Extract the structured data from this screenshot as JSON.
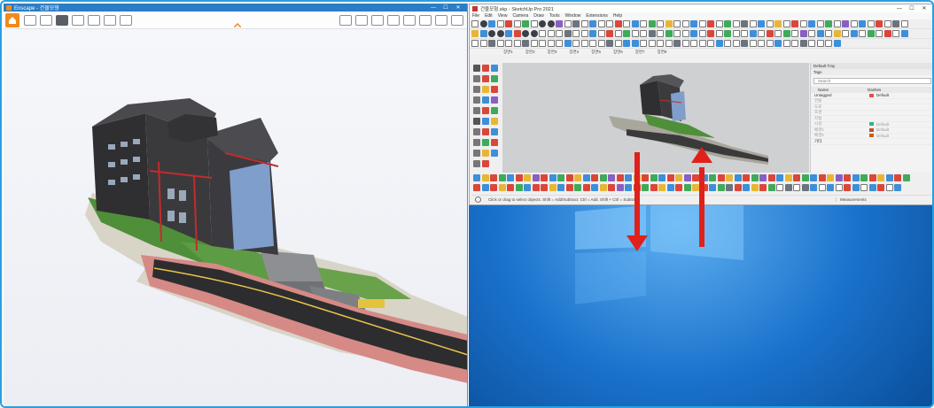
{
  "left_window": {
    "title": "Enscape - 건물모형",
    "controls": {
      "minimize": "—",
      "maximize": "☐",
      "close": "✕"
    }
  },
  "sketchup": {
    "title": "건물모형.skp - SketchUp Pro 2021",
    "controls": {
      "minimize": "—",
      "maximize": "☐",
      "close": "✕"
    },
    "menu": [
      "File",
      "Edit",
      "View",
      "Camera",
      "Draw",
      "Tools",
      "Window",
      "Extensions",
      "Help"
    ],
    "scene_tabs": [
      "장면1",
      "장면2",
      "장면3",
      "장면4",
      "장면5",
      "장면6",
      "장면7",
      "장면8"
    ],
    "tray": {
      "title": "Default Tray",
      "section": "Tags",
      "search_placeholder": "Search",
      "col_name": "Name",
      "col_dashes": "Dashes",
      "rows": [
        {
          "name": "Untagged",
          "dash": "Default",
          "color": "#e05050"
        },
        {
          "name": "건물",
          "dash": "",
          "color": ""
        },
        {
          "name": "도로",
          "dash": "",
          "color": ""
        },
        {
          "name": "조경",
          "dash": "",
          "color": ""
        },
        {
          "name": "지형",
          "dash": "",
          "color": ""
        },
        {
          "name": "시설",
          "dash": "Default",
          "color": "#3faa9a"
        },
        {
          "name": "배경1",
          "dash": "Default",
          "color": "#c0502a"
        },
        {
          "name": "배경2",
          "dash": "Default",
          "color": "#c8601a"
        },
        {
          "name": "기타",
          "dash": "",
          "color": ""
        }
      ]
    },
    "status_hint": "Click or drag to select objects. Shift = Add/Subtract. Ctrl = Add. Shift + Ctrl = Subtract.",
    "measurements_label": "Measurements"
  }
}
